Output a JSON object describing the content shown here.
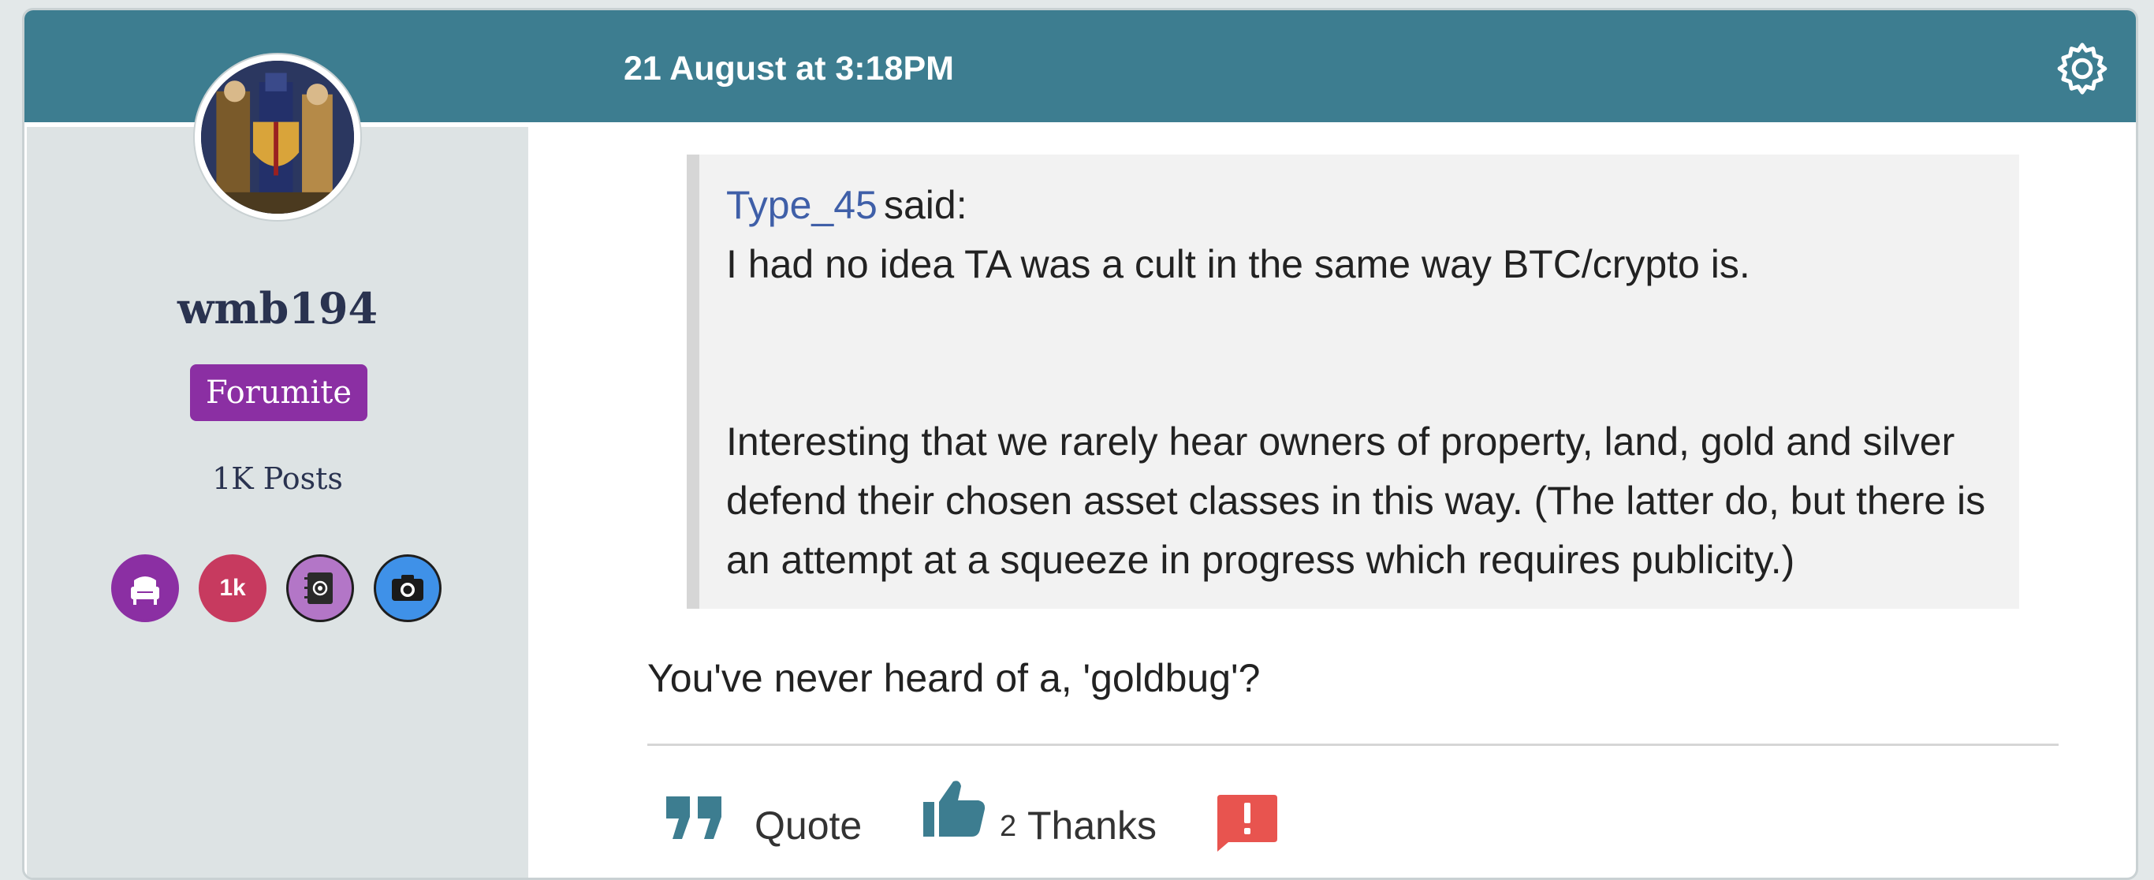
{
  "post": {
    "date": "21 August at 3:18PM"
  },
  "user": {
    "name": "wmb194",
    "rank": "Forumite",
    "posts": "1K Posts",
    "badges": [
      {
        "icon": "armchair-icon",
        "color": "#8b2fa3"
      },
      {
        "label": "1k",
        "color": "#c73a5f"
      },
      {
        "icon": "address-book-icon",
        "color": "#b376c7"
      },
      {
        "icon": "camera-icon",
        "color": "#3f91e8"
      }
    ]
  },
  "quote": {
    "author": "Type_45",
    "said": "said:",
    "line1": "I had no idea TA was a cult in the same way BTC/crypto is.",
    "paragraph": "Interesting that we rarely hear owners of property, land, gold and silver defend their chosen asset classes in this way. (The latter do, but there is an attempt at a squeeze in progress which requires publicity.)"
  },
  "reply": {
    "text": "You've never heard of a, 'goldbug'?"
  },
  "actions": {
    "quote_label": "Quote",
    "thanks_count": "2",
    "thanks_label": "Thanks"
  },
  "colors": {
    "header": "#3d7d90",
    "sidebar": "#dde3e4",
    "rank_badge": "#8b2fa3",
    "link": "#3f5fa8",
    "icon_teal": "#3d7d90",
    "report_red": "#e8544f"
  }
}
